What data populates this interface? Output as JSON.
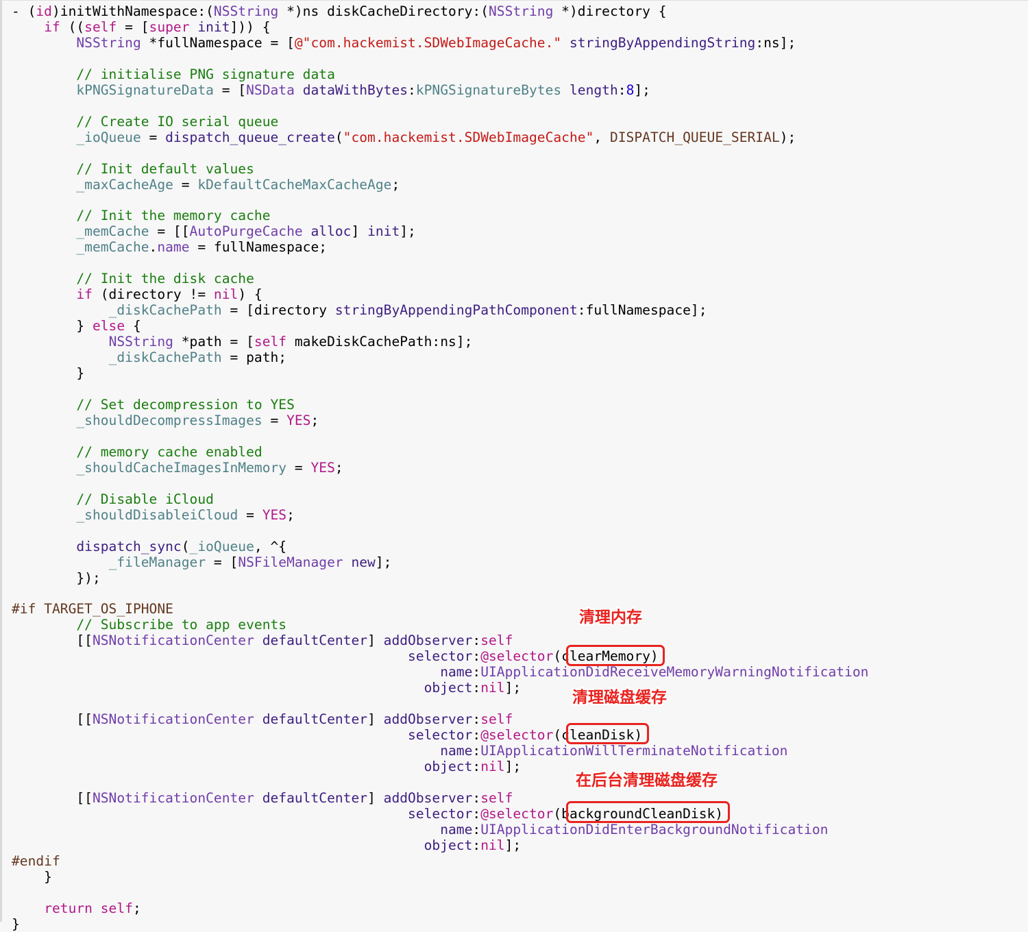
{
  "colors": {
    "background": "#f7f7f7",
    "plain": "#000000",
    "keyword": "#b21889",
    "type": "#703daa",
    "property": "#4f8187",
    "method": "#3d1d81",
    "string": "#c41a16",
    "comment": "#1a7d0f",
    "number": "#1c00cf",
    "preprocessor": "#643820",
    "annotation": "#e8231f"
  },
  "code_lines": [
    [
      [
        "plain",
        "- ("
      ],
      [
        "keyword",
        "id"
      ],
      [
        "plain",
        ")initWithNamespace:("
      ],
      [
        "type",
        "NSString"
      ],
      [
        "plain",
        " *)ns diskCacheDirectory:("
      ],
      [
        "type",
        "NSString"
      ],
      [
        "plain",
        " *)directory {"
      ]
    ],
    [
      [
        "plain",
        "    "
      ],
      [
        "keyword",
        "if"
      ],
      [
        "plain",
        " (("
      ],
      [
        "keyword",
        "self"
      ],
      [
        "plain",
        " = ["
      ],
      [
        "keyword",
        "super"
      ],
      [
        "plain",
        " "
      ],
      [
        "method",
        "init"
      ],
      [
        "plain",
        "])) {"
      ]
    ],
    [
      [
        "plain",
        "        "
      ],
      [
        "type",
        "NSString"
      ],
      [
        "plain",
        " *fullNamespace = ["
      ],
      [
        "string",
        "@\"com.hackemist.SDWebImageCache.\""
      ],
      [
        "plain",
        " "
      ],
      [
        "method",
        "stringByAppendingString"
      ],
      [
        "plain",
        ":ns];"
      ]
    ],
    [],
    [
      [
        "plain",
        "        "
      ],
      [
        "comment",
        "// initialise PNG signature data"
      ]
    ],
    [
      [
        "plain",
        "        "
      ],
      [
        "property",
        "kPNGSignatureData"
      ],
      [
        "plain",
        " = ["
      ],
      [
        "type",
        "NSData"
      ],
      [
        "plain",
        " "
      ],
      [
        "method",
        "dataWithBytes"
      ],
      [
        "plain",
        ":"
      ],
      [
        "property",
        "kPNGSignatureBytes"
      ],
      [
        "plain",
        " "
      ],
      [
        "method",
        "length"
      ],
      [
        "plain",
        ":"
      ],
      [
        "number",
        "8"
      ],
      [
        "plain",
        "];"
      ]
    ],
    [],
    [
      [
        "plain",
        "        "
      ],
      [
        "comment",
        "// Create IO serial queue"
      ]
    ],
    [
      [
        "plain",
        "        "
      ],
      [
        "property",
        "_ioQueue"
      ],
      [
        "plain",
        " = "
      ],
      [
        "method",
        "dispatch_queue_create"
      ],
      [
        "plain",
        "("
      ],
      [
        "string",
        "\"com.hackemist.SDWebImageCache\""
      ],
      [
        "plain",
        ", "
      ],
      [
        "preprocessor",
        "DISPATCH_QUEUE_SERIAL"
      ],
      [
        "plain",
        ");"
      ]
    ],
    [],
    [
      [
        "plain",
        "        "
      ],
      [
        "comment",
        "// Init default values"
      ]
    ],
    [
      [
        "plain",
        "        "
      ],
      [
        "property",
        "_maxCacheAge"
      ],
      [
        "plain",
        " = "
      ],
      [
        "property",
        "kDefaultCacheMaxCacheAge"
      ],
      [
        "plain",
        ";"
      ]
    ],
    [],
    [
      [
        "plain",
        "        "
      ],
      [
        "comment",
        "// Init the memory cache"
      ]
    ],
    [
      [
        "plain",
        "        "
      ],
      [
        "property",
        "_memCache"
      ],
      [
        "plain",
        " = [["
      ],
      [
        "type",
        "AutoPurgeCache"
      ],
      [
        "plain",
        " "
      ],
      [
        "method",
        "alloc"
      ],
      [
        "plain",
        "] "
      ],
      [
        "method",
        "init"
      ],
      [
        "plain",
        "];"
      ]
    ],
    [
      [
        "plain",
        "        "
      ],
      [
        "property",
        "_memCache"
      ],
      [
        "plain",
        "."
      ],
      [
        "type",
        "name"
      ],
      [
        "plain",
        " = fullNamespace;"
      ]
    ],
    [],
    [
      [
        "plain",
        "        "
      ],
      [
        "comment",
        "// Init the disk cache"
      ]
    ],
    [
      [
        "plain",
        "        "
      ],
      [
        "keyword",
        "if"
      ],
      [
        "plain",
        " (directory != "
      ],
      [
        "keyword",
        "nil"
      ],
      [
        "plain",
        ") {"
      ]
    ],
    [
      [
        "plain",
        "            "
      ],
      [
        "property",
        "_diskCachePath"
      ],
      [
        "plain",
        " = [directory "
      ],
      [
        "method",
        "stringByAppendingPathComponent"
      ],
      [
        "plain",
        ":fullNamespace];"
      ]
    ],
    [
      [
        "plain",
        "        } "
      ],
      [
        "keyword",
        "else"
      ],
      [
        "plain",
        " {"
      ]
    ],
    [
      [
        "plain",
        "            "
      ],
      [
        "type",
        "NSString"
      ],
      [
        "plain",
        " *path = ["
      ],
      [
        "keyword",
        "self"
      ],
      [
        "plain",
        " makeDiskCachePath:ns];"
      ]
    ],
    [
      [
        "plain",
        "            "
      ],
      [
        "property",
        "_diskCachePath"
      ],
      [
        "plain",
        " = path;"
      ]
    ],
    [
      [
        "plain",
        "        }"
      ]
    ],
    [],
    [
      [
        "plain",
        "        "
      ],
      [
        "comment",
        "// Set decompression to YES"
      ]
    ],
    [
      [
        "plain",
        "        "
      ],
      [
        "property",
        "_shouldDecompressImages"
      ],
      [
        "plain",
        " = "
      ],
      [
        "keyword",
        "YES"
      ],
      [
        "plain",
        ";"
      ]
    ],
    [],
    [
      [
        "plain",
        "        "
      ],
      [
        "comment",
        "// memory cache enabled"
      ]
    ],
    [
      [
        "plain",
        "        "
      ],
      [
        "property",
        "_shouldCacheImagesInMemory"
      ],
      [
        "plain",
        " = "
      ],
      [
        "keyword",
        "YES"
      ],
      [
        "plain",
        ";"
      ]
    ],
    [],
    [
      [
        "plain",
        "        "
      ],
      [
        "comment",
        "// Disable iCloud"
      ]
    ],
    [
      [
        "plain",
        "        "
      ],
      [
        "property",
        "_shouldDisableiCloud"
      ],
      [
        "plain",
        " = "
      ],
      [
        "keyword",
        "YES"
      ],
      [
        "plain",
        ";"
      ]
    ],
    [],
    [
      [
        "plain",
        "        "
      ],
      [
        "method",
        "dispatch_sync"
      ],
      [
        "plain",
        "("
      ],
      [
        "property",
        "_ioQueue"
      ],
      [
        "plain",
        ", ^{"
      ]
    ],
    [
      [
        "plain",
        "            "
      ],
      [
        "property",
        "_fileManager"
      ],
      [
        "plain",
        " = ["
      ],
      [
        "type",
        "NSFileManager"
      ],
      [
        "plain",
        " "
      ],
      [
        "method",
        "new"
      ],
      [
        "plain",
        "];"
      ]
    ],
    [
      [
        "plain",
        "        });"
      ]
    ],
    [],
    [
      [
        "preprocessor",
        "#if TARGET_OS_IPHONE"
      ]
    ],
    [
      [
        "plain",
        "        "
      ],
      [
        "comment",
        "// Subscribe to app events"
      ]
    ],
    [
      [
        "plain",
        "        [["
      ],
      [
        "type",
        "NSNotificationCenter"
      ],
      [
        "plain",
        " "
      ],
      [
        "method",
        "defaultCenter"
      ],
      [
        "plain",
        "] "
      ],
      [
        "method",
        "addObserver"
      ],
      [
        "plain",
        ":"
      ],
      [
        "keyword",
        "self"
      ]
    ],
    [
      [
        "plain",
        "                                                 "
      ],
      [
        "method",
        "selector"
      ],
      [
        "plain",
        ":"
      ],
      [
        "keyword",
        "@selector"
      ],
      [
        "plain",
        "(clearMemory)"
      ]
    ],
    [
      [
        "plain",
        "                                                     "
      ],
      [
        "method",
        "name"
      ],
      [
        "plain",
        ":"
      ],
      [
        "type",
        "UIApplicationDidReceiveMemoryWarningNotification"
      ]
    ],
    [
      [
        "plain",
        "                                                   "
      ],
      [
        "method",
        "object"
      ],
      [
        "plain",
        ":"
      ],
      [
        "keyword",
        "nil"
      ],
      [
        "plain",
        "];"
      ]
    ],
    [],
    [
      [
        "plain",
        "        [["
      ],
      [
        "type",
        "NSNotificationCenter"
      ],
      [
        "plain",
        " "
      ],
      [
        "method",
        "defaultCenter"
      ],
      [
        "plain",
        "] "
      ],
      [
        "method",
        "addObserver"
      ],
      [
        "plain",
        ":"
      ],
      [
        "keyword",
        "self"
      ]
    ],
    [
      [
        "plain",
        "                                                 "
      ],
      [
        "method",
        "selector"
      ],
      [
        "plain",
        ":"
      ],
      [
        "keyword",
        "@selector"
      ],
      [
        "plain",
        "(cleanDisk)"
      ]
    ],
    [
      [
        "plain",
        "                                                     "
      ],
      [
        "method",
        "name"
      ],
      [
        "plain",
        ":"
      ],
      [
        "type",
        "UIApplicationWillTerminateNotification"
      ]
    ],
    [
      [
        "plain",
        "                                                   "
      ],
      [
        "method",
        "object"
      ],
      [
        "plain",
        ":"
      ],
      [
        "keyword",
        "nil"
      ],
      [
        "plain",
        "];"
      ]
    ],
    [],
    [
      [
        "plain",
        "        [["
      ],
      [
        "type",
        "NSNotificationCenter"
      ],
      [
        "plain",
        " "
      ],
      [
        "method",
        "defaultCenter"
      ],
      [
        "plain",
        "] "
      ],
      [
        "method",
        "addObserver"
      ],
      [
        "plain",
        ":"
      ],
      [
        "keyword",
        "self"
      ]
    ],
    [
      [
        "plain",
        "                                                 "
      ],
      [
        "method",
        "selector"
      ],
      [
        "plain",
        ":"
      ],
      [
        "keyword",
        "@selector"
      ],
      [
        "plain",
        "(backgroundCleanDisk)"
      ]
    ],
    [
      [
        "plain",
        "                                                     "
      ],
      [
        "method",
        "name"
      ],
      [
        "plain",
        ":"
      ],
      [
        "type",
        "UIApplicationDidEnterBackgroundNotification"
      ]
    ],
    [
      [
        "plain",
        "                                                   "
      ],
      [
        "method",
        "object"
      ],
      [
        "plain",
        ":"
      ],
      [
        "keyword",
        "nil"
      ],
      [
        "plain",
        "];"
      ]
    ],
    [
      [
        "preprocessor",
        "#endif"
      ]
    ],
    [
      [
        "plain",
        "    }"
      ]
    ],
    [],
    [
      [
        "plain",
        "    "
      ],
      [
        "keyword",
        "return"
      ],
      [
        "plain",
        " "
      ],
      [
        "keyword",
        "self"
      ],
      [
        "plain",
        ";"
      ]
    ],
    [
      [
        "plain",
        "}"
      ]
    ]
  ],
  "annotations": [
    {
      "label": "清理内存",
      "highlighted": "clearMemory"
    },
    {
      "label": "清理磁盘缓存",
      "highlighted": "cleanDisk"
    },
    {
      "label": "在后台清理磁盘缓存",
      "highlighted": "backgroundCleanDisk"
    }
  ]
}
